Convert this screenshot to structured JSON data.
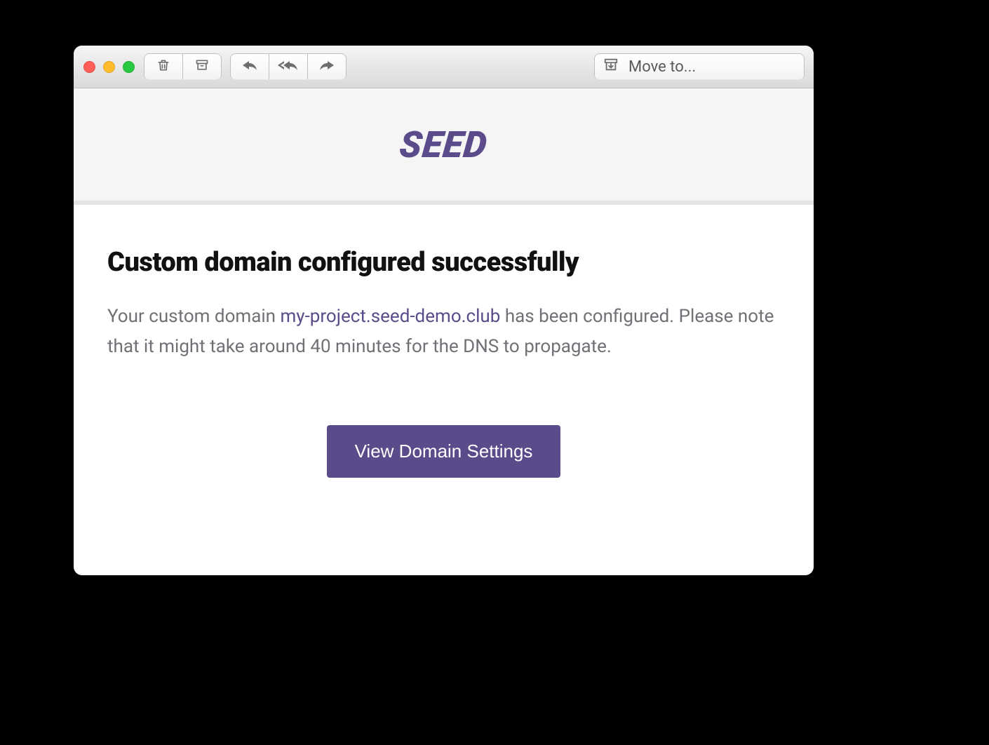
{
  "toolbar": {
    "move_to_label": "Move to..."
  },
  "email": {
    "logo_text": "SEED",
    "heading": "Custom domain configured successfully",
    "body_pre": "Your custom domain ",
    "domain": "my-project.seed-demo.club",
    "body_post": " has been configured. Please note that it might take around 40 minutes for the DNS to propagate.",
    "cta_label": "View Domain Settings"
  },
  "colors": {
    "accent": "#5b4b8a"
  }
}
